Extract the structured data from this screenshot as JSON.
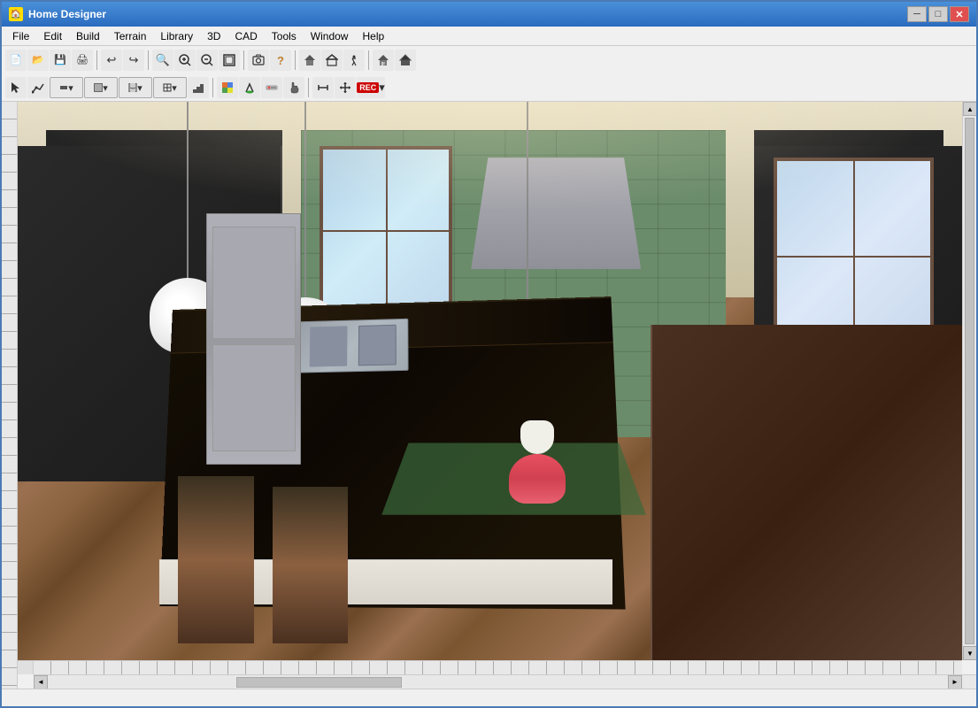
{
  "window": {
    "title": "Home Designer",
    "icon": "🏠"
  },
  "titlebar": {
    "minimize_label": "─",
    "maximize_label": "□",
    "close_label": "✕",
    "controls_min": "─",
    "controls_max": "□",
    "controls_close": "✕"
  },
  "menubar": {
    "items": [
      {
        "id": "file",
        "label": "File"
      },
      {
        "id": "edit",
        "label": "Edit"
      },
      {
        "id": "build",
        "label": "Build"
      },
      {
        "id": "terrain",
        "label": "Terrain"
      },
      {
        "id": "library",
        "label": "Library"
      },
      {
        "id": "3d",
        "label": "3D"
      },
      {
        "id": "cad",
        "label": "CAD"
      },
      {
        "id": "tools",
        "label": "Tools"
      },
      {
        "id": "window",
        "label": "Window"
      },
      {
        "id": "help",
        "label": "Help"
      }
    ]
  },
  "toolbar1": {
    "buttons": [
      {
        "id": "new",
        "icon": "📄",
        "tooltip": "New"
      },
      {
        "id": "open",
        "icon": "📁",
        "tooltip": "Open"
      },
      {
        "id": "save",
        "icon": "💾",
        "tooltip": "Save"
      },
      {
        "id": "print",
        "icon": "🖨",
        "tooltip": "Print"
      },
      {
        "id": "undo",
        "icon": "↩",
        "tooltip": "Undo"
      },
      {
        "id": "redo",
        "icon": "↪",
        "tooltip": "Redo"
      },
      {
        "id": "zoom-fit",
        "icon": "🔍",
        "tooltip": "Zoom Fit"
      },
      {
        "id": "zoom-in",
        "icon": "+",
        "tooltip": "Zoom In"
      },
      {
        "id": "zoom-out",
        "icon": "−",
        "tooltip": "Zoom Out"
      },
      {
        "id": "fullscreen",
        "icon": "⛶",
        "tooltip": "Full Screen"
      },
      {
        "id": "camera",
        "icon": "📷",
        "tooltip": "Camera"
      },
      {
        "id": "help2",
        "icon": "?",
        "tooltip": "Help"
      },
      {
        "id": "wall",
        "icon": "⬜",
        "tooltip": "Wall"
      },
      {
        "id": "roof",
        "icon": "⌂",
        "tooltip": "Roof"
      },
      {
        "id": "stairs",
        "icon": "≣",
        "tooltip": "Stairs"
      }
    ]
  },
  "toolbar2": {
    "buttons": [
      {
        "id": "select",
        "icon": "↖",
        "tooltip": "Select"
      },
      {
        "id": "polyline",
        "icon": "∟",
        "tooltip": "Polyline"
      },
      {
        "id": "wall-tool",
        "icon": "─",
        "tooltip": "Wall Tool"
      },
      {
        "id": "cabinet",
        "icon": "▦",
        "tooltip": "Cabinet"
      },
      {
        "id": "door",
        "icon": "⬜",
        "tooltip": "Door"
      },
      {
        "id": "window",
        "icon": "⊞",
        "tooltip": "Window"
      },
      {
        "id": "stair",
        "icon": "▤",
        "tooltip": "Stair"
      },
      {
        "id": "material",
        "icon": "◧",
        "tooltip": "Material"
      },
      {
        "id": "paint",
        "icon": "✏",
        "tooltip": "Paint"
      },
      {
        "id": "texture",
        "icon": "▨",
        "tooltip": "Texture"
      },
      {
        "id": "hand",
        "icon": "✋",
        "tooltip": "Hand"
      },
      {
        "id": "dimension",
        "icon": "↔",
        "tooltip": "Dimension"
      },
      {
        "id": "transform",
        "icon": "⤡",
        "tooltip": "Transform"
      },
      {
        "id": "rec",
        "icon": "REC",
        "tooltip": "Record"
      }
    ]
  },
  "scene": {
    "description": "3D kitchen interior view with dark cabinets, granite island, pendant lights, green tile backsplash, hardwood floors"
  },
  "statusbar": {
    "text": ""
  }
}
